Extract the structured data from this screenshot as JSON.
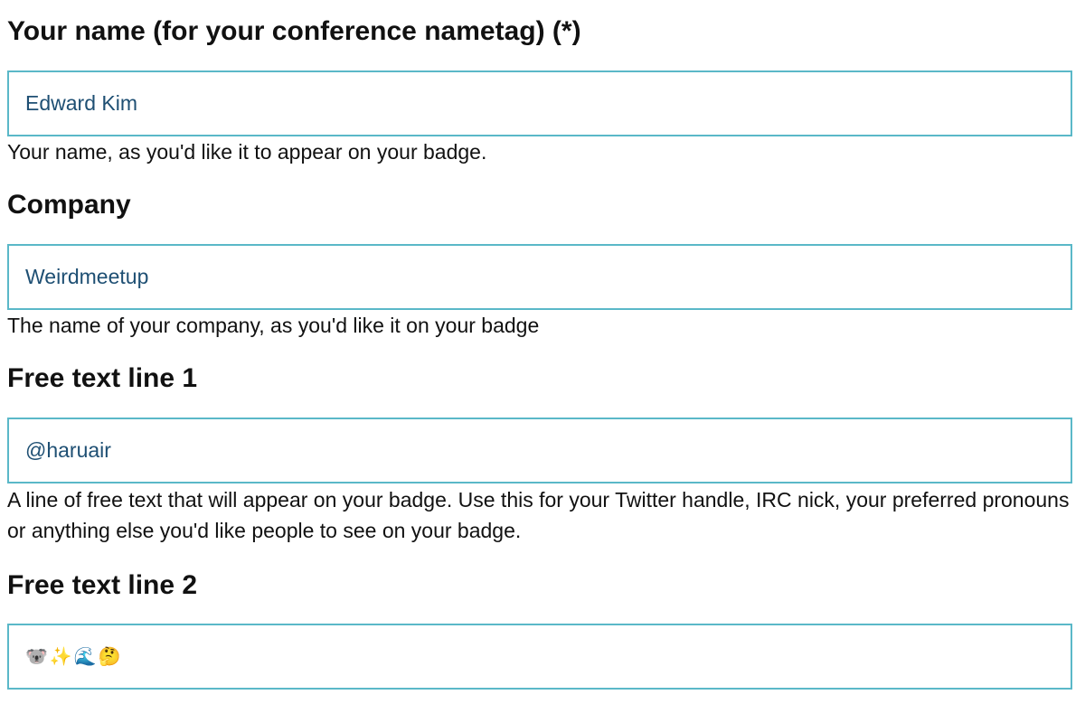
{
  "fields": [
    {
      "label": "Your name (for your conference nametag) (*)",
      "value": "Edward Kim",
      "help": "Your name, as you'd like it to appear on your badge."
    },
    {
      "label": "Company",
      "value": "Weirdmeetup",
      "help": "The name of your company, as you'd like it on your badge"
    },
    {
      "label": "Free text line 1",
      "value": "@haruair",
      "help": "A line of free text that will appear on your badge. Use this for your Twitter handle, IRC nick, your preferred pronouns or anything else you'd like people to see on your badge."
    },
    {
      "label": "Free text line 2",
      "value": "🐨✨🌊🤔",
      "emojis": [
        "🐨",
        "✨",
        "🌊",
        "🤔"
      ]
    }
  ],
  "colors": {
    "input_border": "#5ab8c8",
    "input_text": "#1e4f73",
    "label_text": "#111111"
  }
}
